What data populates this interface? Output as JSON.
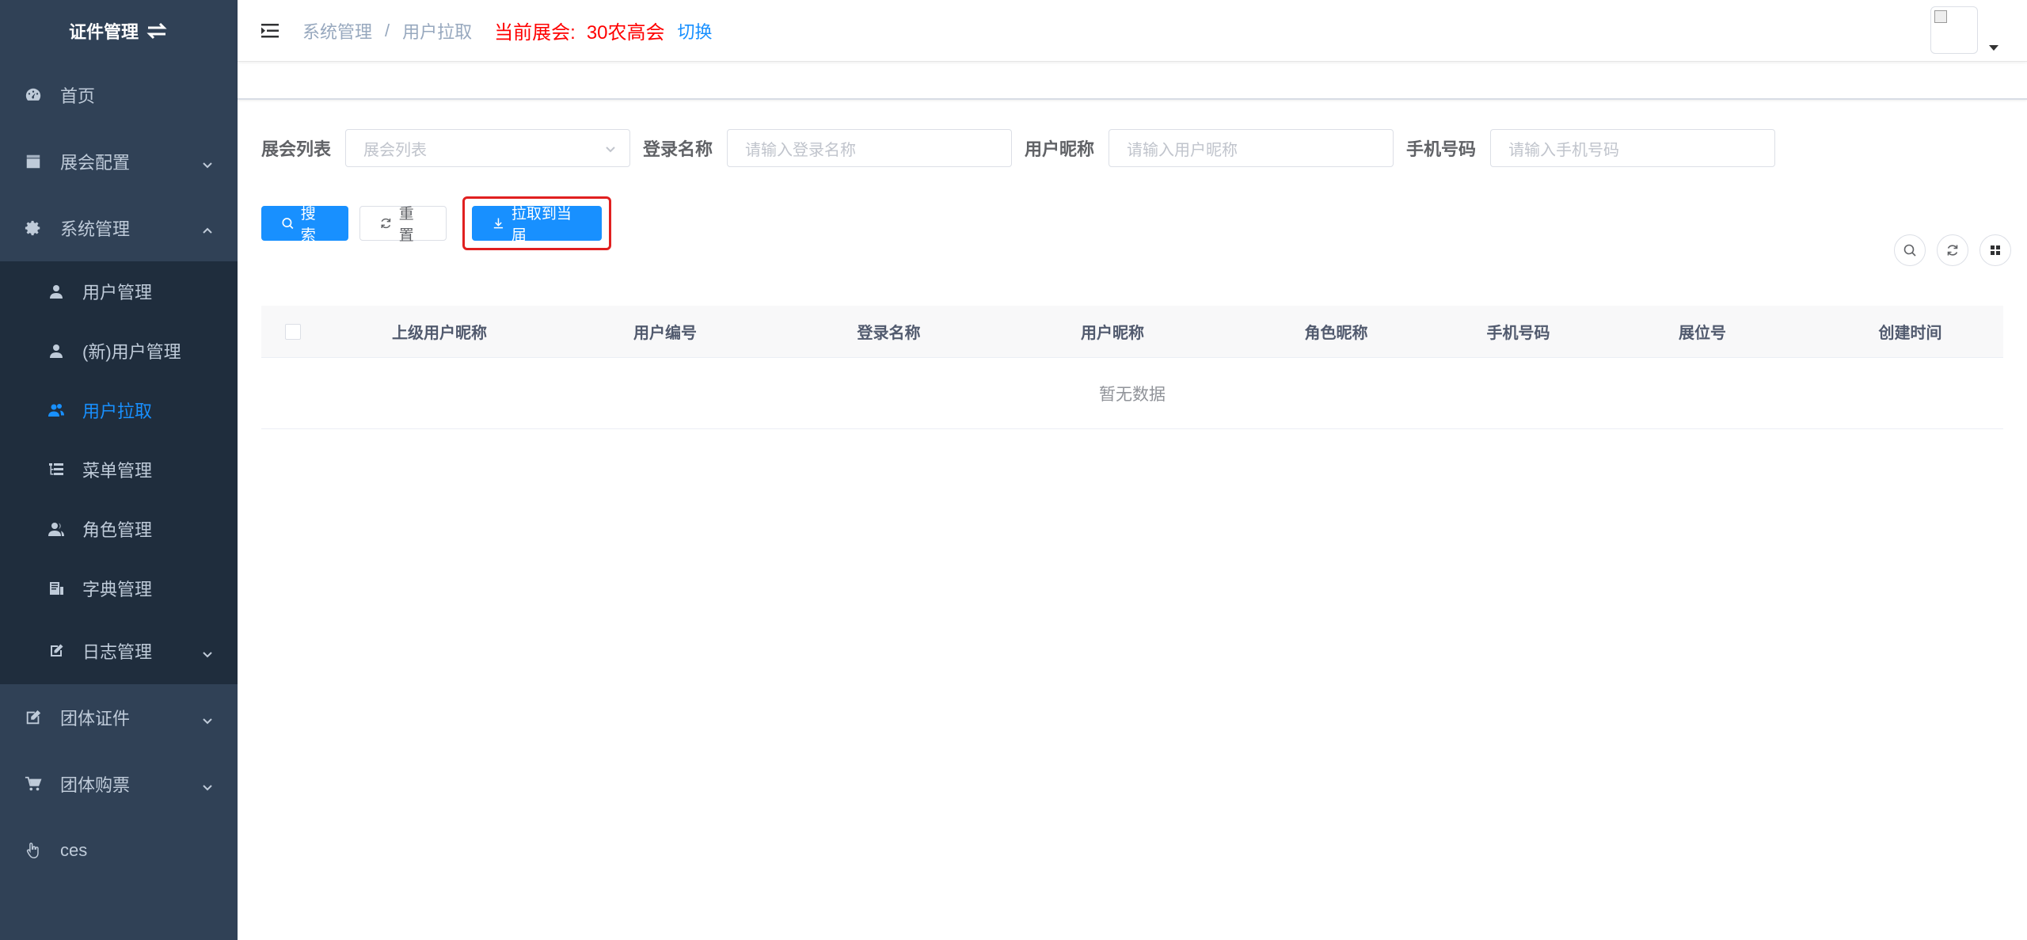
{
  "sidebar": {
    "logo_text": "证件管理",
    "items": [
      {
        "label": "首页"
      },
      {
        "label": "展会配置"
      },
      {
        "label": "系统管理"
      },
      {
        "label": "团体证件"
      },
      {
        "label": "团体购票"
      },
      {
        "label": "ces"
      }
    ],
    "submenu": [
      {
        "label": "用户管理"
      },
      {
        "label": "(新)用户管理"
      },
      {
        "label": "用户拉取"
      },
      {
        "label": "菜单管理"
      },
      {
        "label": "角色管理"
      },
      {
        "label": "字典管理"
      },
      {
        "label": "日志管理"
      }
    ]
  },
  "navbar": {
    "breadcrumb": [
      "系统管理",
      "用户拉取"
    ],
    "breadcrumb_sep": "/",
    "current_expo_label": "当前展会:",
    "current_expo_name": "30农高会",
    "switch_label": "切换"
  },
  "search": {
    "expo_list_label": "展会列表",
    "expo_list_placeholder": "展会列表",
    "login_name_label": "登录名称",
    "login_name_placeholder": "请输入登录名称",
    "nickname_label": "用户昵称",
    "nickname_placeholder": "请输入用户昵称",
    "phone_label": "手机号码",
    "phone_placeholder": "请输入手机号码"
  },
  "buttons": {
    "search": "搜索",
    "reset": "重置",
    "pull": "拉取到当届"
  },
  "table": {
    "columns": [
      "上级用户昵称",
      "用户编号",
      "登录名称",
      "用户昵称",
      "角色昵称",
      "手机号码",
      "展位号",
      "创建时间"
    ],
    "empty_text": "暂无数据"
  },
  "colors": {
    "sidebar_bg": "#304156",
    "submenu_bg": "#1f2d3d",
    "primary": "#1890ff",
    "expo_red": "#ff0000",
    "highlight_red": "#e02020"
  }
}
